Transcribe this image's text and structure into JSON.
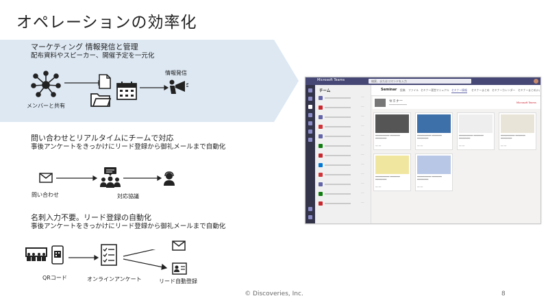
{
  "slide": {
    "title": "オペレーションの効率化",
    "footer": "© Discoveries, Inc.",
    "page_number": "8"
  },
  "section1": {
    "heading": "マーケティング 情報発信と管理",
    "subheading": "配布資料やスピーカー、開催予定を一元化",
    "label_share": "メンバーと共有",
    "label_broadcast": "情報発信",
    "band_color": "#dde8f3",
    "icons": [
      "network-icon",
      "document-icon",
      "folder-icon",
      "calendar-icon",
      "megaphone-icon"
    ]
  },
  "section2": {
    "heading": "問い合わせとリアルタイムにチームで対応",
    "subheading": "事後アンケートをきっかけにリード登録から御礼メールまで自動化",
    "label_inquiry": "問い合わせ",
    "label_response": "対応協議",
    "icons": [
      "mail-icon",
      "team-chat-icon",
      "support-agent-icon"
    ]
  },
  "section3": {
    "heading": "名刺入力不要。リード登録の自動化",
    "subheading": "事後アンケートをきっかけにリード登録から御礼メールまで自動化",
    "label_qr": "QRコード",
    "label_survey": "オンラインアンケート",
    "label_lead": "リード自動登録",
    "icons": [
      "audience-icon",
      "phone-qr-icon",
      "checklist-icon",
      "mail-icon",
      "contact-card-icon"
    ]
  },
  "teams": {
    "app_name": "Microsoft Teams",
    "search_placeholder": "検索、またはコマンドを入力",
    "panel_title": "チーム",
    "channel_name": "Seminar",
    "tabs": [
      "投稿",
      "ファイル",
      "セミナー運営マニュアル",
      "セミナー情報",
      "セミナーまとめ",
      "セミナーカレンダー",
      "セミナーまとめ(2)"
    ],
    "active_tab": "セミナー情報",
    "banner_title": "セミナー",
    "banner_logo": "Microsoft Teams",
    "accent": "#464775",
    "team_colors": [
      "#6264a7",
      "#c8282d",
      "#6264a7",
      "#d13438",
      "#6264a7",
      "#107c10",
      "#c8282d",
      "#0078d4",
      "#d13438",
      "#6264a7",
      "#107c10",
      "#c8282d"
    ]
  }
}
